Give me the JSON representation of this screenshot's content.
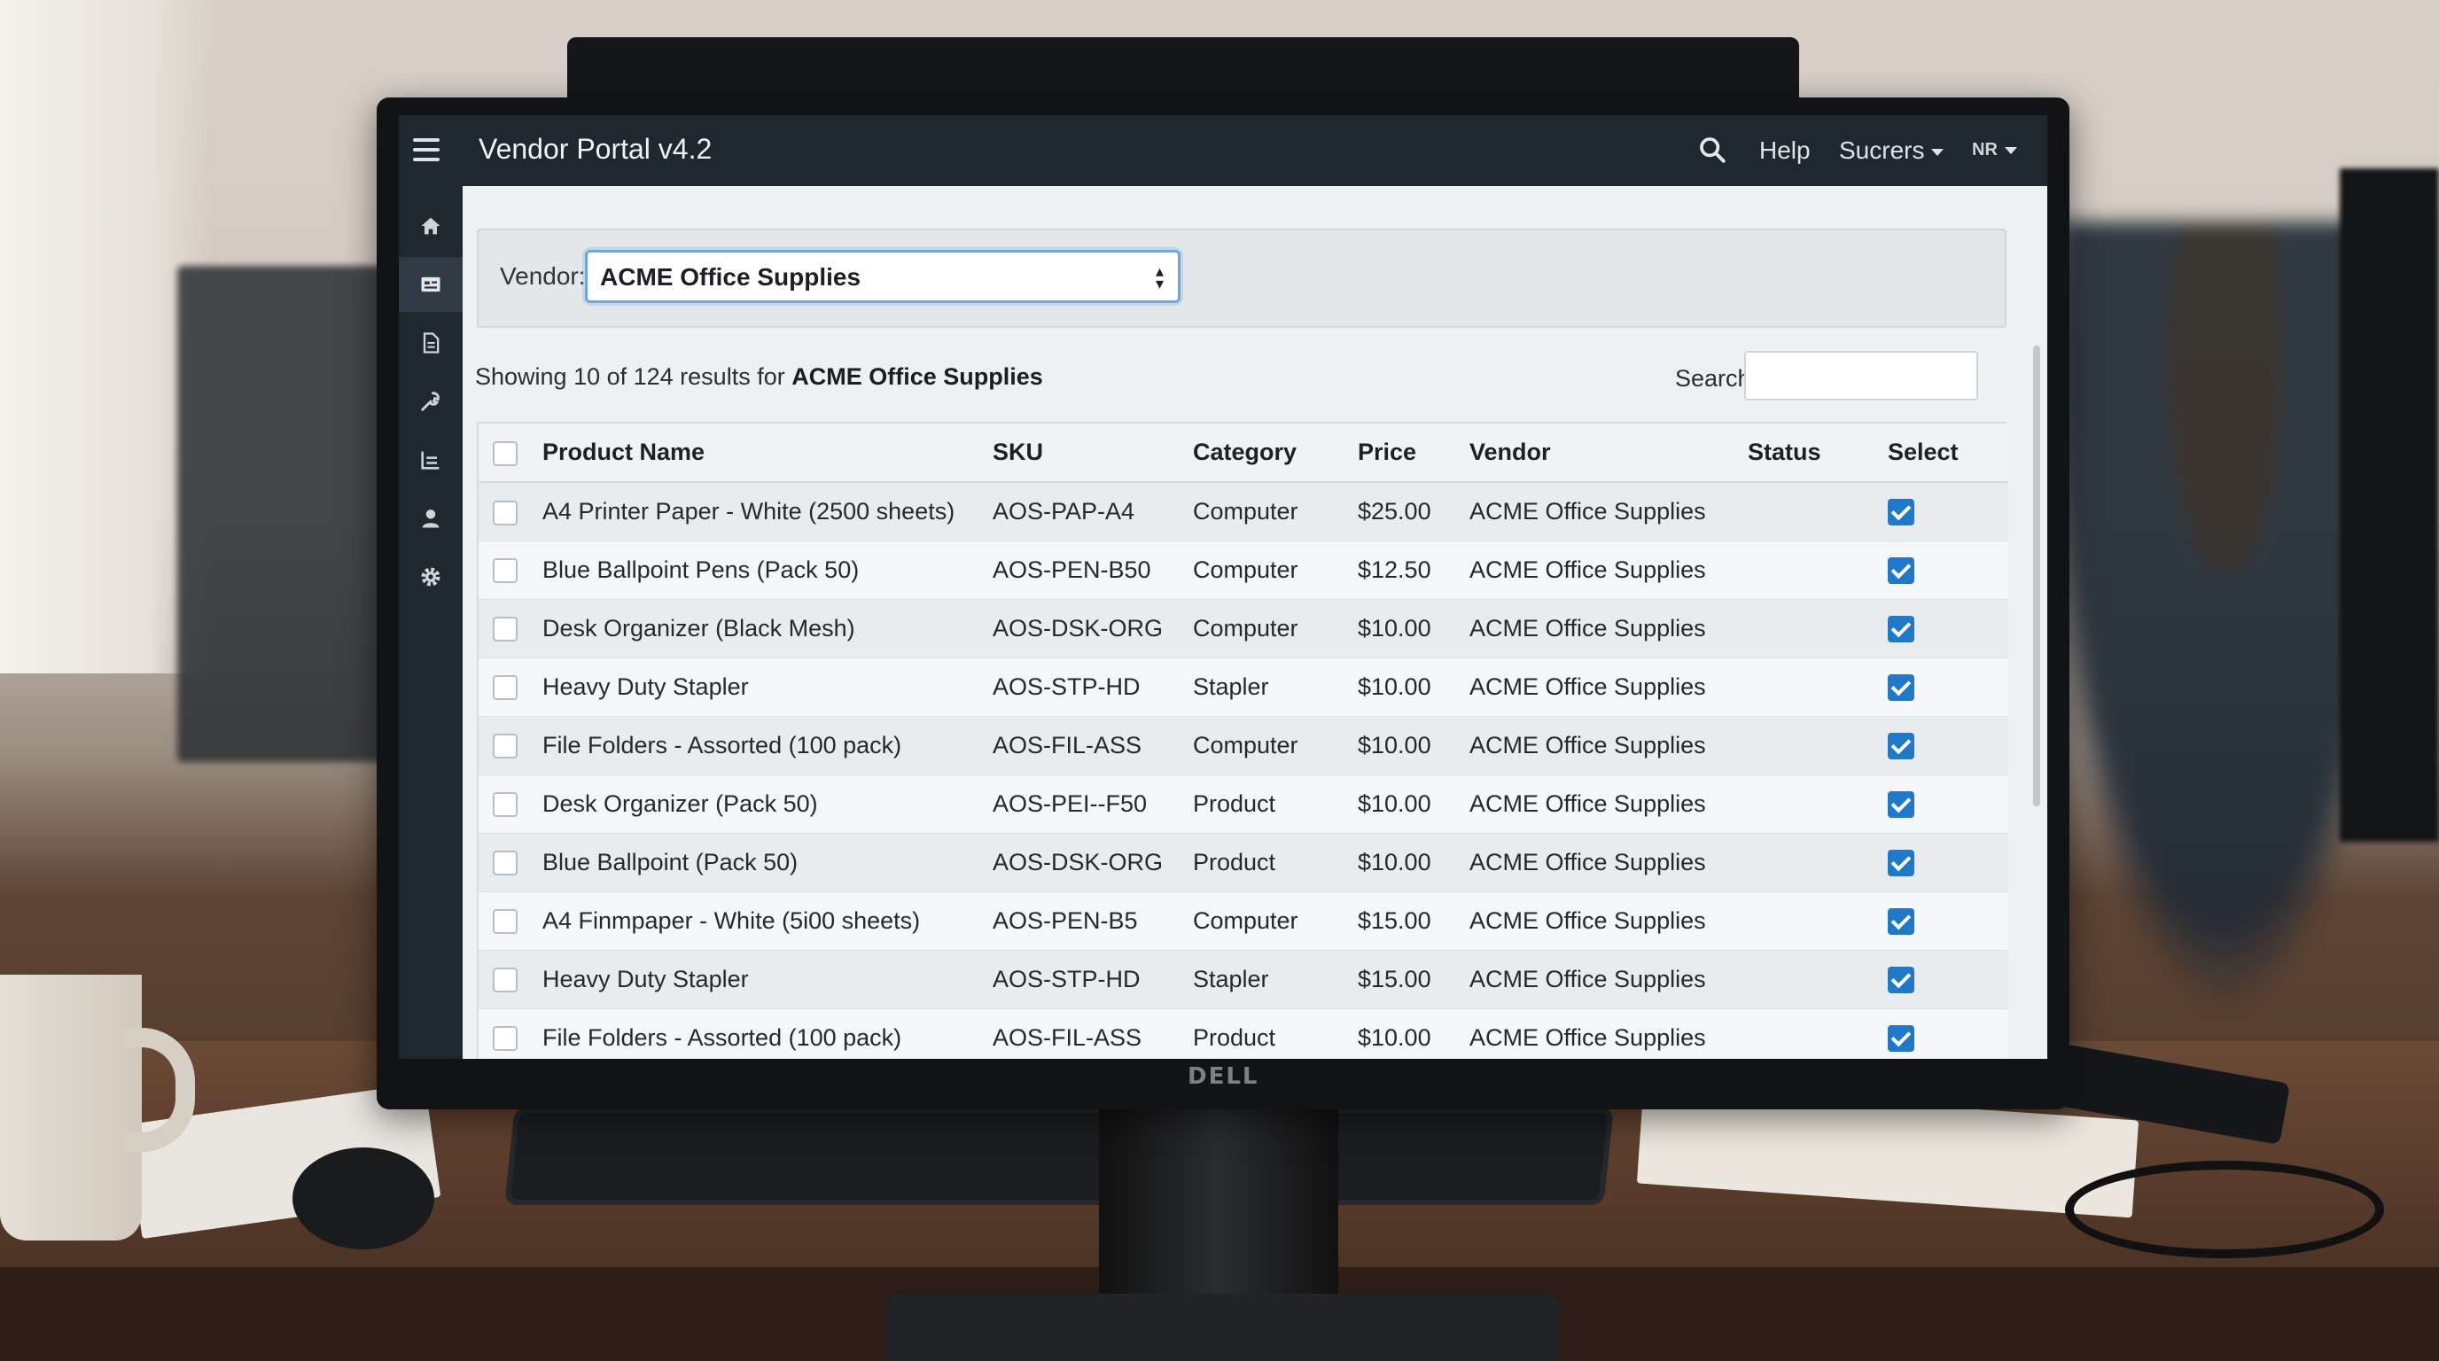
{
  "app": {
    "title": "Vendor Portal v4.2",
    "help_label": "Help",
    "users_label": "Sucrers",
    "user_initials": "NR"
  },
  "sidebar": {
    "items": [
      {
        "icon": "home-icon",
        "active": false
      },
      {
        "icon": "catalog-icon",
        "active": true
      },
      {
        "icon": "document-icon",
        "active": false
      },
      {
        "icon": "tools-icon",
        "active": false
      },
      {
        "icon": "reports-icon",
        "active": false
      },
      {
        "icon": "user-icon",
        "active": false
      },
      {
        "icon": "gear-icon",
        "active": false
      }
    ]
  },
  "vendor_filter": {
    "label": "Vendor:",
    "selected": "ACME Office Supplies"
  },
  "results": {
    "prefix": "Showing 10 of 124 results for",
    "vendor": "ACME Office Supplies"
  },
  "search": {
    "label": "Search:",
    "value": ""
  },
  "table": {
    "headers": {
      "product": "Product Name",
      "sku": "SKU",
      "category": "Category",
      "price": "Price",
      "vendor": "Vendor",
      "status": "Status",
      "select": "Select"
    },
    "rows": [
      {
        "product": "A4 Printer Paper - White (2500 sheets)",
        "sku": "AOS-PAP-A4",
        "category": "Computer",
        "price": "$25.00",
        "vendor": "ACME Office Supplies",
        "status": "",
        "selected": true
      },
      {
        "product": "Blue Ballpoint Pens (Pack 50)",
        "sku": "AOS-PEN-B50",
        "category": "Computer",
        "price": "$12.50",
        "vendor": "ACME Office Supplies",
        "status": "",
        "selected": true
      },
      {
        "product": "Desk Organizer (Black Mesh)",
        "sku": "AOS-DSK-ORG",
        "category": "Computer",
        "price": "$10.00",
        "vendor": "ACME Office Supplies",
        "status": "",
        "selected": true
      },
      {
        "product": "Heavy Duty Stapler",
        "sku": "AOS-STP-HD",
        "category": "Stapler",
        "price": "$10.00",
        "vendor": "ACME Office Supplies",
        "status": "",
        "selected": true
      },
      {
        "product": "File Folders - Assorted (100 pack)",
        "sku": "AOS-FIL-ASS",
        "category": "Computer",
        "price": "$10.00",
        "vendor": "ACME Office Supplies",
        "status": "",
        "selected": true
      },
      {
        "product": "Desk Organizer (Pack 50)",
        "sku": "AOS-PEI--F50",
        "category": "Product",
        "price": "$10.00",
        "vendor": "ACME Office Supplies",
        "status": "",
        "selected": true
      },
      {
        "product": "Blue Ballpoint (Pack 50)",
        "sku": "AOS-DSK-ORG",
        "category": "Product",
        "price": "$10.00",
        "vendor": "ACME Office Supplies",
        "status": "",
        "selected": true
      },
      {
        "product": "A4 Finmpaper - White (5i00 sheets)",
        "sku": "AOS-PEN-B5",
        "category": "Computer",
        "price": "$15.00",
        "vendor": "ACME Office Supplies",
        "status": "",
        "selected": true
      },
      {
        "product": "Heavy Duty Stapler",
        "sku": "AOS-STP-HD",
        "category": "Stapler",
        "price": "$15.00",
        "vendor": "ACME Office Supplies",
        "status": "",
        "selected": true
      },
      {
        "product": "File Folders - Assorted (100 pack)",
        "sku": "AOS-FIL-ASS",
        "category": "Product",
        "price": "$10.00",
        "vendor": "ACME Office Supplies",
        "status": "",
        "selected": true
      }
    ]
  },
  "monitor": {
    "brand": "DELL"
  },
  "colors": {
    "topbar": "#1f272f",
    "accent": "#1f78c8",
    "select_border": "#6fa6dd"
  }
}
